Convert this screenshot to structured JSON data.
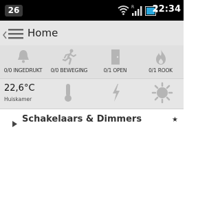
{
  "status_bar": {
    "notification_count": "26",
    "time": "22:34",
    "icons": [
      "wifi-icon",
      "signal-icon",
      "battery-icon"
    ],
    "battery_color": "#29a8dd"
  },
  "action_bar": {
    "title": "Home",
    "icons": [
      "back-chevron-icon",
      "menu-icon"
    ]
  },
  "sensors": [
    {
      "icon": "bell-icon",
      "label": "0/0 INGEDRUKT"
    },
    {
      "icon": "running-person-icon",
      "label": "0/0 BEWEGING"
    },
    {
      "icon": "door-icon",
      "label": "0/1 OPEN"
    },
    {
      "icon": "flame-icon",
      "label": "0/1 ROOK"
    }
  ],
  "climate": {
    "temperature": "22,6°C",
    "room": "Huiskamer",
    "icons": [
      "thermometer-icon",
      "lightning-icon",
      "sun-icon"
    ]
  },
  "groups": [
    {
      "label": "Schakelaars & Dimmers",
      "star": "★"
    }
  ]
}
